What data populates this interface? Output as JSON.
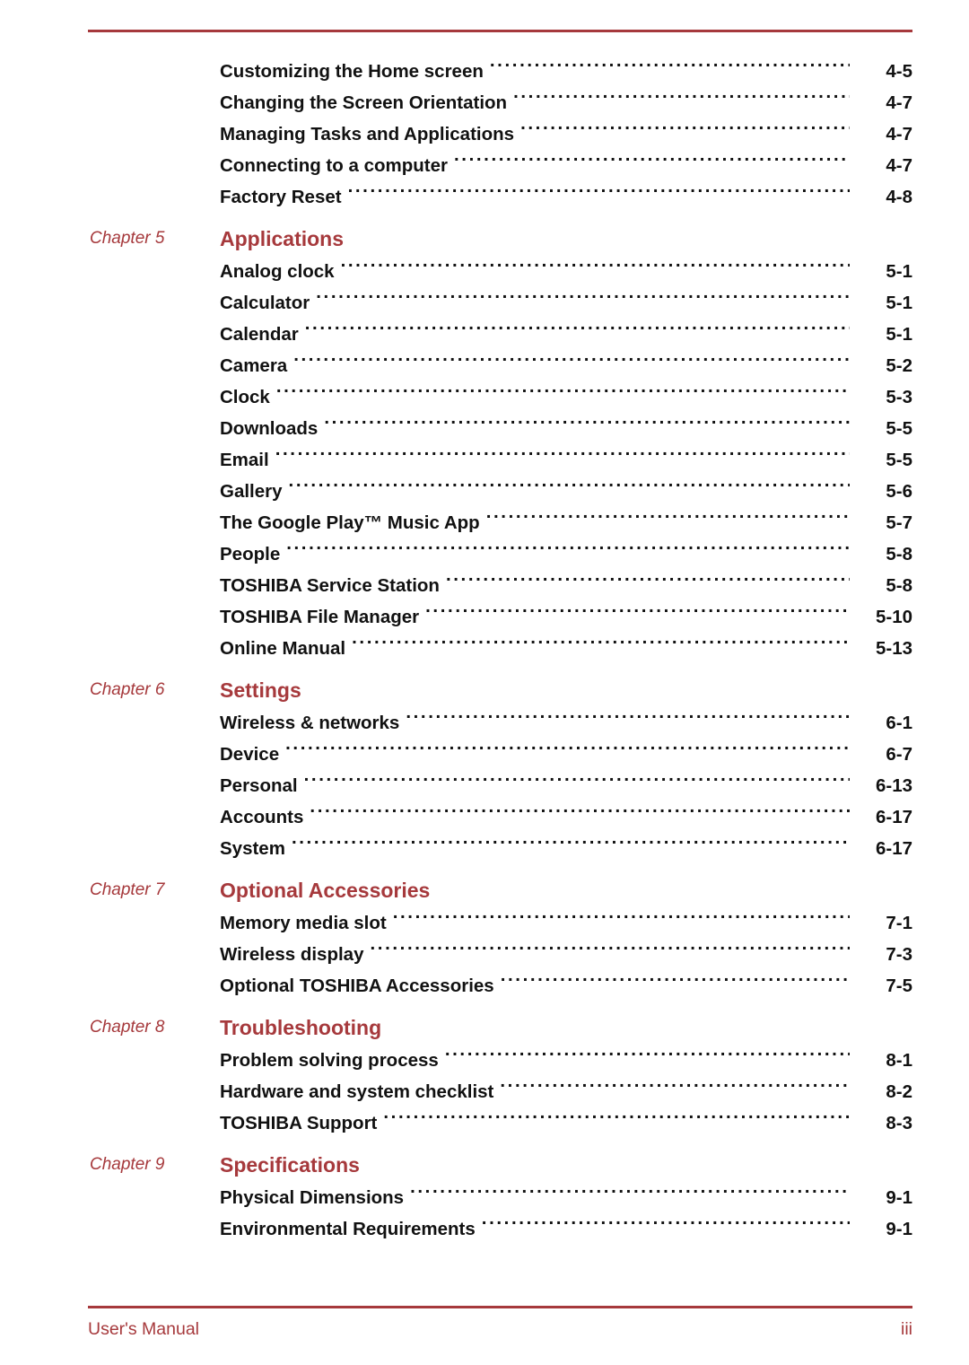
{
  "document": {
    "type": "table-of-contents",
    "accent_color": "#a6393c",
    "text_color": "#111111"
  },
  "footer": {
    "left_label": "User's Manual",
    "page_number": "iii"
  },
  "continued_entries": [
    {
      "title": "Customizing the Home screen",
      "page": "4-5"
    },
    {
      "title": "Changing the Screen Orientation",
      "page": "4-7"
    },
    {
      "title": "Managing Tasks and Applications",
      "page": "4-7"
    },
    {
      "title": "Connecting to a computer",
      "page": "4-7"
    },
    {
      "title": "Factory Reset",
      "page": "4-8"
    }
  ],
  "chapters": [
    {
      "label": "Chapter 5",
      "title": "Applications",
      "entries": [
        {
          "title": "Analog clock",
          "page": "5-1"
        },
        {
          "title": "Calculator",
          "page": "5-1"
        },
        {
          "title": "Calendar",
          "page": "5-1"
        },
        {
          "title": "Camera",
          "page": "5-2"
        },
        {
          "title": "Clock",
          "page": "5-3"
        },
        {
          "title": "Downloads",
          "page": "5-5"
        },
        {
          "title": "Email",
          "page": "5-5"
        },
        {
          "title": "Gallery",
          "page": "5-6"
        },
        {
          "title": "The Google Play™ Music App",
          "page": "5-7"
        },
        {
          "title": "People",
          "page": "5-8"
        },
        {
          "title": "TOSHIBA Service Station",
          "page": "5-8"
        },
        {
          "title": "TOSHIBA File Manager",
          "page": "5-10"
        },
        {
          "title": "Online Manual",
          "page": "5-13"
        }
      ]
    },
    {
      "label": "Chapter 6",
      "title": "Settings",
      "entries": [
        {
          "title": "Wireless & networks",
          "page": "6-1"
        },
        {
          "title": "Device",
          "page": "6-7"
        },
        {
          "title": "Personal",
          "page": "6-13"
        },
        {
          "title": "Accounts",
          "page": "6-17"
        },
        {
          "title": "System",
          "page": "6-17"
        }
      ]
    },
    {
      "label": "Chapter 7",
      "title": "Optional Accessories",
      "entries": [
        {
          "title": "Memory media slot",
          "page": "7-1"
        },
        {
          "title": "Wireless display",
          "page": "7-3"
        },
        {
          "title": "Optional TOSHIBA Accessories",
          "page": "7-5"
        }
      ]
    },
    {
      "label": "Chapter 8",
      "title": "Troubleshooting",
      "entries": [
        {
          "title": "Problem solving process",
          "page": "8-1"
        },
        {
          "title": "Hardware and system checklist",
          "page": "8-2"
        },
        {
          "title": "TOSHIBA Support",
          "page": "8-3"
        }
      ]
    },
    {
      "label": "Chapter 9",
      "title": "Specifications",
      "entries": [
        {
          "title": "Physical Dimensions",
          "page": "9-1"
        },
        {
          "title": "Environmental Requirements",
          "page": "9-1"
        }
      ]
    }
  ]
}
